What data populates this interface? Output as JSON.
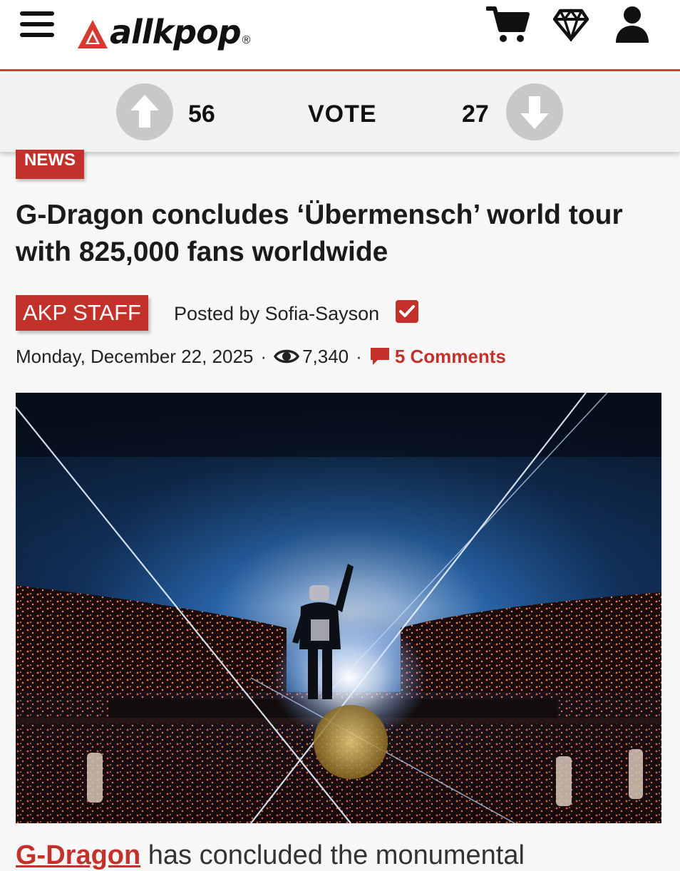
{
  "header": {
    "logo_text": "allkpop",
    "logo_reg": "®",
    "brand_color": "#d73a31"
  },
  "vote": {
    "up_count": "56",
    "label": "VOTE",
    "down_count": "27"
  },
  "article": {
    "category": "NEWS",
    "title": "G-Dragon concludes ‘Übermensch’ world tour with 825,000 fans worldwide",
    "staff_badge": "AKP STAFF",
    "posted_by": "Posted by Sofia-Sayson",
    "date": "Monday, December 22, 2025",
    "views": "7,340",
    "comments": "5 Comments",
    "body_link": "G-Dragon",
    "body_text": " has concluded the monumental"
  },
  "colors": {
    "accent": "#c3312b",
    "vote_button": "#c8c8c8"
  }
}
